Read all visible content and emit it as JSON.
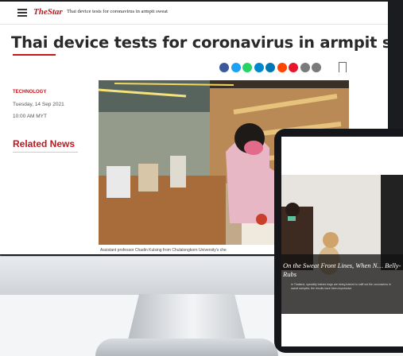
{
  "header": {
    "logo": "TheStar",
    "breadcrumb": "Thai device tests for coronavirus in armpit sweat"
  },
  "article": {
    "title": "Thai device tests for coronavirus in armpit sweat",
    "category": "TECHNOLOGY",
    "date": "Tuesday, 14 Sep 2021",
    "time": "10:00 AM MYT",
    "caption": "Assistant professor Chadin Kulsing from Chulalongkorn University's che"
  },
  "sidebar": {
    "related_title": "Related News"
  },
  "share_buttons": [
    {
      "icon": "facebook-icon",
      "color": "#3b5998"
    },
    {
      "icon": "twitter-icon",
      "color": "#1da1f2"
    },
    {
      "icon": "whatsapp-icon",
      "color": "#25d366"
    },
    {
      "icon": "telegram-icon",
      "color": "#0088cc"
    },
    {
      "icon": "linkedin-icon",
      "color": "#0077b5"
    },
    {
      "icon": "reddit-icon",
      "color": "#ff4500"
    },
    {
      "icon": "weibo-icon",
      "color": "#e6162d"
    },
    {
      "icon": "email-icon",
      "color": "#7a7a7a"
    },
    {
      "icon": "print-icon",
      "color": "#7a7a7a"
    }
  ],
  "tablet": {
    "headline": "On the Sweat Front Lines, When N… Belly-Rubs",
    "subtext": "In Thailand, specially trained dogs are being trained to sniff out the coronavirus in sweat samples; the results have been impressive."
  },
  "colors": {
    "accent": "#c4161c",
    "bezel": "#1b1c1f"
  }
}
